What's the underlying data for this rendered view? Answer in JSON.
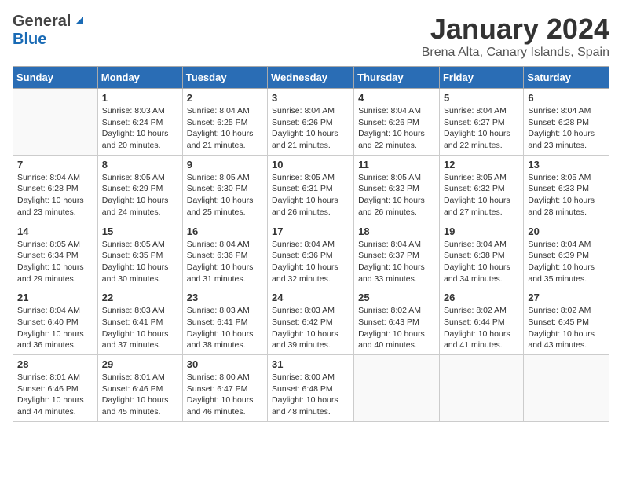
{
  "header": {
    "logo_general": "General",
    "logo_blue": "Blue",
    "month_year": "January 2024",
    "location": "Brena Alta, Canary Islands, Spain"
  },
  "calendar": {
    "days_of_week": [
      "Sunday",
      "Monday",
      "Tuesday",
      "Wednesday",
      "Thursday",
      "Friday",
      "Saturday"
    ],
    "weeks": [
      [
        {
          "day": "",
          "content": ""
        },
        {
          "day": "1",
          "content": "Sunrise: 8:03 AM\nSunset: 6:24 PM\nDaylight: 10 hours\nand 20 minutes."
        },
        {
          "day": "2",
          "content": "Sunrise: 8:04 AM\nSunset: 6:25 PM\nDaylight: 10 hours\nand 21 minutes."
        },
        {
          "day": "3",
          "content": "Sunrise: 8:04 AM\nSunset: 6:26 PM\nDaylight: 10 hours\nand 21 minutes."
        },
        {
          "day": "4",
          "content": "Sunrise: 8:04 AM\nSunset: 6:26 PM\nDaylight: 10 hours\nand 22 minutes."
        },
        {
          "day": "5",
          "content": "Sunrise: 8:04 AM\nSunset: 6:27 PM\nDaylight: 10 hours\nand 22 minutes."
        },
        {
          "day": "6",
          "content": "Sunrise: 8:04 AM\nSunset: 6:28 PM\nDaylight: 10 hours\nand 23 minutes."
        }
      ],
      [
        {
          "day": "7",
          "content": "Sunrise: 8:04 AM\nSunset: 6:28 PM\nDaylight: 10 hours\nand 23 minutes."
        },
        {
          "day": "8",
          "content": "Sunrise: 8:05 AM\nSunset: 6:29 PM\nDaylight: 10 hours\nand 24 minutes."
        },
        {
          "day": "9",
          "content": "Sunrise: 8:05 AM\nSunset: 6:30 PM\nDaylight: 10 hours\nand 25 minutes."
        },
        {
          "day": "10",
          "content": "Sunrise: 8:05 AM\nSunset: 6:31 PM\nDaylight: 10 hours\nand 26 minutes."
        },
        {
          "day": "11",
          "content": "Sunrise: 8:05 AM\nSunset: 6:32 PM\nDaylight: 10 hours\nand 26 minutes."
        },
        {
          "day": "12",
          "content": "Sunrise: 8:05 AM\nSunset: 6:32 PM\nDaylight: 10 hours\nand 27 minutes."
        },
        {
          "day": "13",
          "content": "Sunrise: 8:05 AM\nSunset: 6:33 PM\nDaylight: 10 hours\nand 28 minutes."
        }
      ],
      [
        {
          "day": "14",
          "content": "Sunrise: 8:05 AM\nSunset: 6:34 PM\nDaylight: 10 hours\nand 29 minutes."
        },
        {
          "day": "15",
          "content": "Sunrise: 8:05 AM\nSunset: 6:35 PM\nDaylight: 10 hours\nand 30 minutes."
        },
        {
          "day": "16",
          "content": "Sunrise: 8:04 AM\nSunset: 6:36 PM\nDaylight: 10 hours\nand 31 minutes."
        },
        {
          "day": "17",
          "content": "Sunrise: 8:04 AM\nSunset: 6:36 PM\nDaylight: 10 hours\nand 32 minutes."
        },
        {
          "day": "18",
          "content": "Sunrise: 8:04 AM\nSunset: 6:37 PM\nDaylight: 10 hours\nand 33 minutes."
        },
        {
          "day": "19",
          "content": "Sunrise: 8:04 AM\nSunset: 6:38 PM\nDaylight: 10 hours\nand 34 minutes."
        },
        {
          "day": "20",
          "content": "Sunrise: 8:04 AM\nSunset: 6:39 PM\nDaylight: 10 hours\nand 35 minutes."
        }
      ],
      [
        {
          "day": "21",
          "content": "Sunrise: 8:04 AM\nSunset: 6:40 PM\nDaylight: 10 hours\nand 36 minutes."
        },
        {
          "day": "22",
          "content": "Sunrise: 8:03 AM\nSunset: 6:41 PM\nDaylight: 10 hours\nand 37 minutes."
        },
        {
          "day": "23",
          "content": "Sunrise: 8:03 AM\nSunset: 6:41 PM\nDaylight: 10 hours\nand 38 minutes."
        },
        {
          "day": "24",
          "content": "Sunrise: 8:03 AM\nSunset: 6:42 PM\nDaylight: 10 hours\nand 39 minutes."
        },
        {
          "day": "25",
          "content": "Sunrise: 8:02 AM\nSunset: 6:43 PM\nDaylight: 10 hours\nand 40 minutes."
        },
        {
          "day": "26",
          "content": "Sunrise: 8:02 AM\nSunset: 6:44 PM\nDaylight: 10 hours\nand 41 minutes."
        },
        {
          "day": "27",
          "content": "Sunrise: 8:02 AM\nSunset: 6:45 PM\nDaylight: 10 hours\nand 43 minutes."
        }
      ],
      [
        {
          "day": "28",
          "content": "Sunrise: 8:01 AM\nSunset: 6:46 PM\nDaylight: 10 hours\nand 44 minutes."
        },
        {
          "day": "29",
          "content": "Sunrise: 8:01 AM\nSunset: 6:46 PM\nDaylight: 10 hours\nand 45 minutes."
        },
        {
          "day": "30",
          "content": "Sunrise: 8:00 AM\nSunset: 6:47 PM\nDaylight: 10 hours\nand 46 minutes."
        },
        {
          "day": "31",
          "content": "Sunrise: 8:00 AM\nSunset: 6:48 PM\nDaylight: 10 hours\nand 48 minutes."
        },
        {
          "day": "",
          "content": ""
        },
        {
          "day": "",
          "content": ""
        },
        {
          "day": "",
          "content": ""
        }
      ]
    ]
  }
}
